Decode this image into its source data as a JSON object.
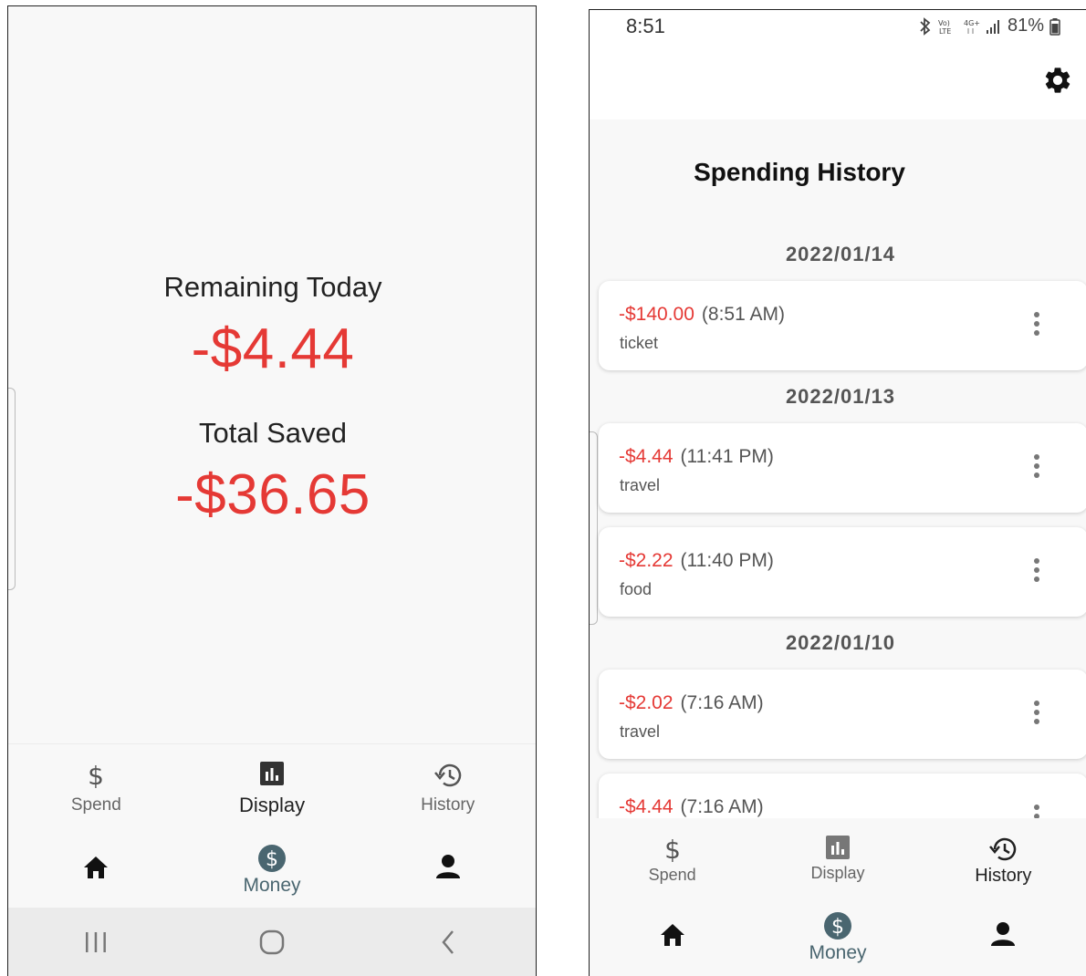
{
  "left_screen": {
    "remaining_label": "Remaining Today",
    "remaining_value": "-$4.44",
    "saved_label": "Total Saved",
    "saved_value": "-$36.65",
    "tabs": [
      {
        "label": "Spend",
        "icon": "dollar-icon",
        "active": false
      },
      {
        "label": "Display",
        "icon": "bar-chart-icon",
        "active": true
      },
      {
        "label": "History",
        "icon": "history-icon",
        "active": false
      }
    ],
    "bottom_nav": [
      {
        "icon": "home-icon"
      },
      {
        "icon": "money-icon",
        "label": "Money"
      },
      {
        "icon": "person-icon"
      }
    ],
    "system_nav": [
      "recents-button",
      "home-button",
      "back-button"
    ]
  },
  "right_screen": {
    "status": {
      "time": "8:51",
      "battery": "81%"
    },
    "title": "Spending History",
    "groups": [
      {
        "date": "2022/01/14",
        "entries": [
          {
            "amount": "-$140.00",
            "time": "(8:51 AM)",
            "note": "ticket"
          }
        ]
      },
      {
        "date": "2022/01/13",
        "entries": [
          {
            "amount": "-$4.44",
            "time": "(11:41 PM)",
            "note": "travel"
          },
          {
            "amount": "-$2.22",
            "time": "(11:40 PM)",
            "note": "food"
          }
        ]
      },
      {
        "date": "2022/01/10",
        "entries": [
          {
            "amount": "-$2.02",
            "time": "(7:16 AM)",
            "note": "travel"
          },
          {
            "amount": "-$4.44",
            "time": "(7:16 AM)",
            "note": ""
          }
        ]
      }
    ],
    "tabs": [
      {
        "label": "Spend",
        "icon": "dollar-icon",
        "active": false
      },
      {
        "label": "Display",
        "icon": "bar-chart-icon",
        "active": false
      },
      {
        "label": "History",
        "icon": "history-icon",
        "active": true
      }
    ],
    "bottom_nav": [
      {
        "icon": "home-icon"
      },
      {
        "icon": "money-icon",
        "label": "Money"
      },
      {
        "icon": "person-icon"
      }
    ]
  },
  "colors": {
    "negative": "#e53935",
    "money_accent": "#4a6670",
    "background": "#f8f8f8",
    "card": "#ffffff"
  }
}
